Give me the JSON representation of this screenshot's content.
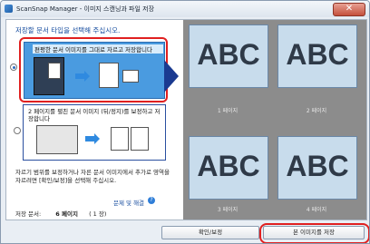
{
  "window": {
    "title": "ScanSnap Manager - 이미지 스캔닝과 파일 저장"
  },
  "left": {
    "instruction": "저장할 문서 타입을 선택해 주십시오.",
    "option1_label": "편평한 문서 이미지를 그대로 자르고 저장합니다",
    "option2_label": "2 페이지를 펼친 문서 이미지 (뒤/정지)를 보정하고 저장합니다",
    "description": "자르기 범위를 보정하거나 자른 문서 이미지에서 추가로 영역을 자르려면 [확인/보정]을 선택해 주십시오.",
    "help_link": "문제 및 해결",
    "status_label": "저장 문서:",
    "status_pages": "6 페이지",
    "status_paren": "( 1",
    "status_unit": "장)"
  },
  "thumbnails": [
    {
      "text": "ABC",
      "label": "1 페이지"
    },
    {
      "text": "ABC",
      "label": "2 페이지"
    },
    {
      "text": "ABC",
      "label": "3 페이지"
    },
    {
      "text": "ABC",
      "label": "4 페이지"
    }
  ],
  "footer": {
    "check_button": "확인/보정",
    "save_button": "본 이미지를 저장"
  },
  "colors": {
    "accent": "#4a9be0",
    "highlight": "#e02020",
    "nav_arrow": "#1a3a90"
  }
}
